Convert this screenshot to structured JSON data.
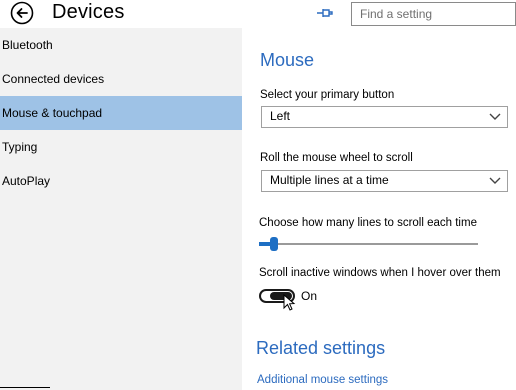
{
  "header": {
    "title": "Devices",
    "search_placeholder": "Find a setting"
  },
  "sidebar": {
    "items": [
      {
        "label": "Bluetooth"
      },
      {
        "label": "Connected devices"
      },
      {
        "label": "Mouse & touchpad"
      },
      {
        "label": "Typing"
      },
      {
        "label": "AutoPlay"
      }
    ],
    "selected_item": "Mouse & touchpad"
  },
  "main": {
    "heading": "Mouse",
    "primary_button": {
      "label": "Select your primary button",
      "value": "Left"
    },
    "scroll_wheel": {
      "label": "Roll the mouse wheel to scroll",
      "value": "Multiple lines at a time"
    },
    "lines_slider": {
      "label": "Choose how many lines to scroll each time",
      "level": 0.05
    },
    "scroll_inactive": {
      "label": "Scroll inactive windows when I hover over them",
      "state": "On"
    },
    "related_heading": "Related settings",
    "related_link": "Additional mouse settings"
  },
  "colors": {
    "accent": "#2c6bbf",
    "slider": "#1e6fc4",
    "selected_bg": "#9ec2e6",
    "sidebar_bg": "#f2f2f2"
  },
  "icons": {
    "back": "back-arrow-icon",
    "pin": "pin-icon",
    "chevron": "chevron-down-icon",
    "cursor": "mouse-pointer-icon"
  }
}
